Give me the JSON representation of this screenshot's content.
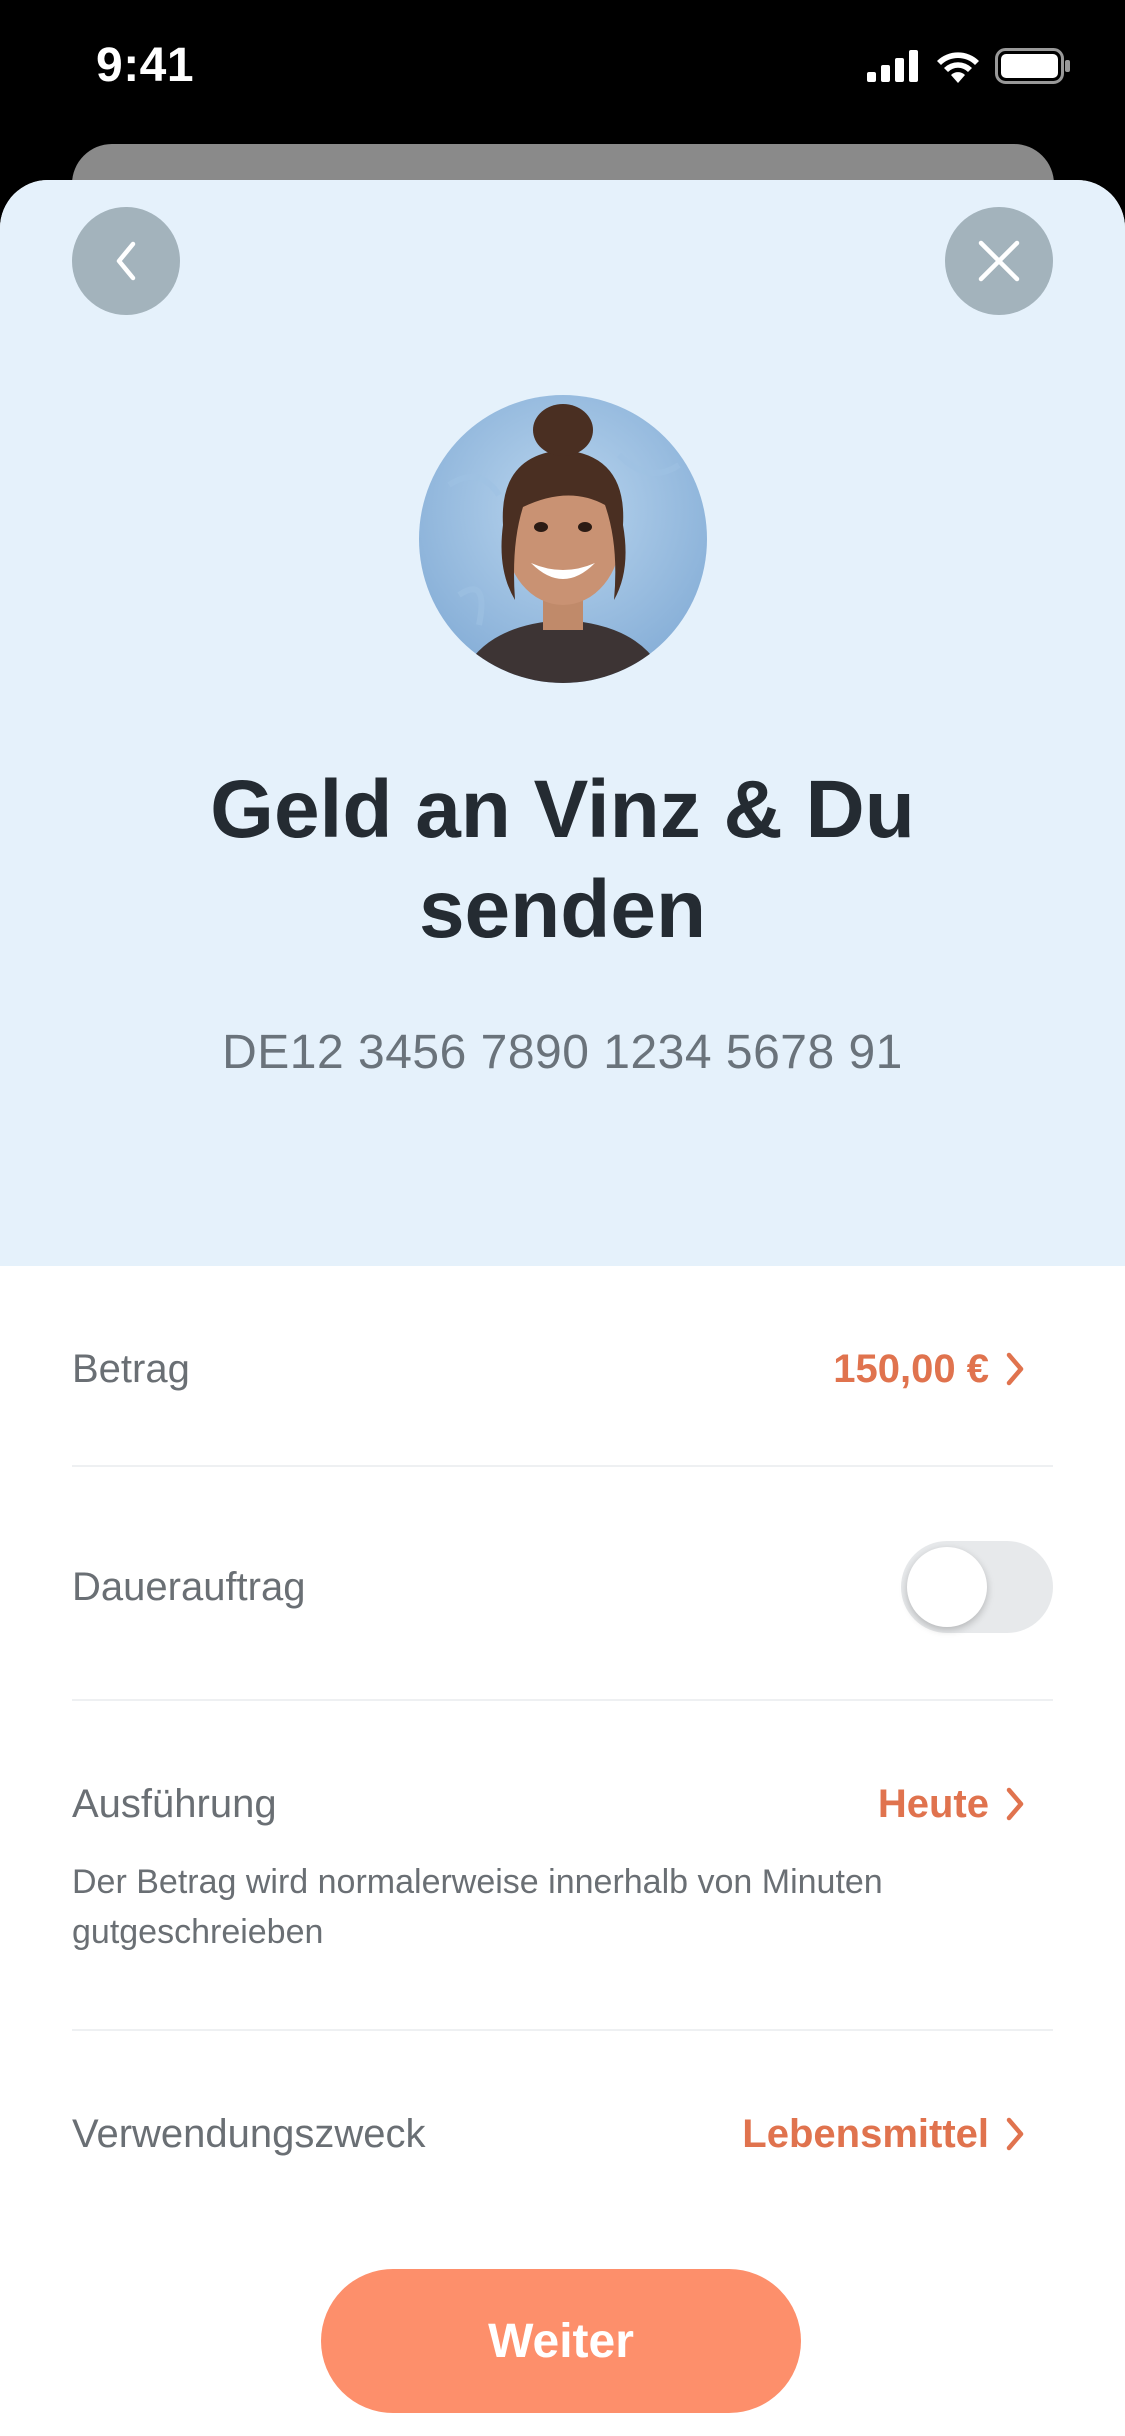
{
  "status_bar": {
    "time": "9:41"
  },
  "recipient": {
    "title": "Geld an Vinz & Du senden",
    "iban": "DE12 3456 7890 1234 5678 91"
  },
  "nav": {
    "back_icon": "chevron-left-icon",
    "close_icon": "close-icon"
  },
  "rows": {
    "amount": {
      "label": "Betrag",
      "value": "150,00 €"
    },
    "standing_order": {
      "label": "Dauerauftrag",
      "enabled": false
    },
    "execution": {
      "label": "Ausführung",
      "value": "Heute",
      "note": "Der Betrag wird normalerweise innerhalb von Minuten gutgeschreieben"
    },
    "purpose": {
      "label": "Verwendungszweck",
      "value": "Lebensmittel"
    }
  },
  "cta": {
    "label": "Weiter"
  },
  "colors": {
    "accent": "#e0734e",
    "button": "#fd8f6b",
    "header_bg": "#e5f1fb",
    "title": "#242b32"
  }
}
